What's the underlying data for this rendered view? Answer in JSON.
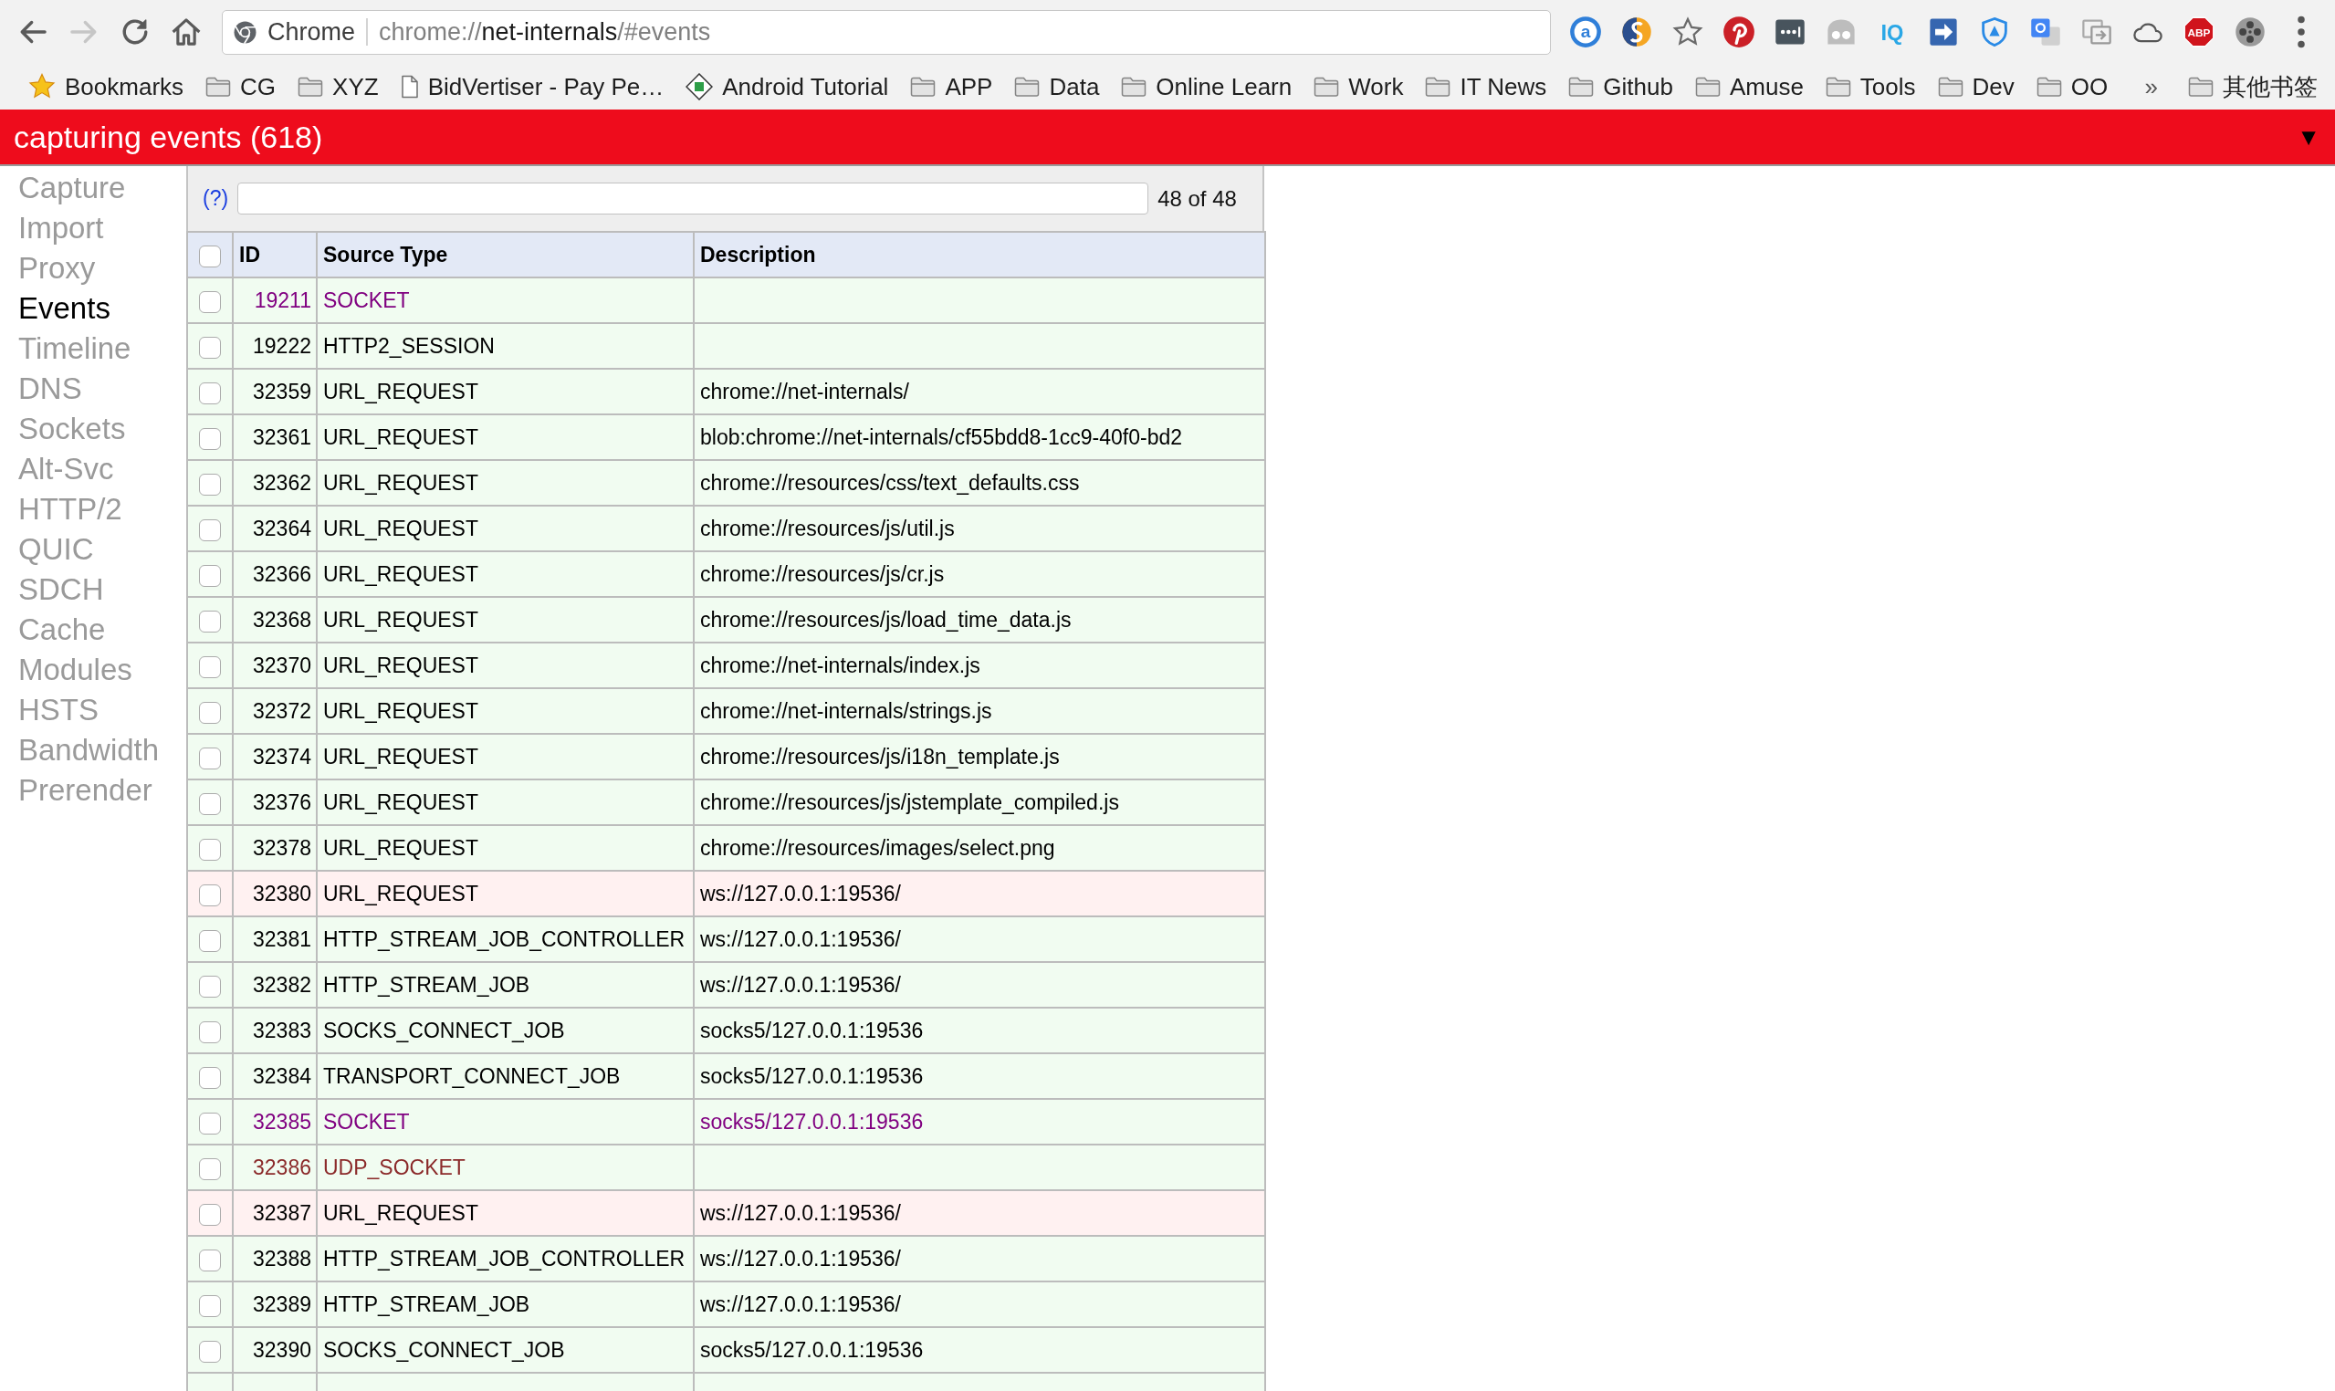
{
  "toolbar": {
    "back_disabled": false,
    "forward_disabled": true,
    "site_label": "Chrome",
    "url": "chrome://net-internals/#events",
    "extension_icon_texts": [
      "a",
      "IQ",
      "ABP"
    ]
  },
  "bookmarks_bar": {
    "items": [
      {
        "label": "Bookmarks",
        "kind": "manager"
      },
      {
        "label": "CG",
        "kind": "folder"
      },
      {
        "label": "XYZ",
        "kind": "folder"
      },
      {
        "label": "BidVertiser - Pay Pe…",
        "kind": "page"
      },
      {
        "label": "Android Tutorial",
        "kind": "site"
      },
      {
        "label": "APP",
        "kind": "folder"
      },
      {
        "label": "Data",
        "kind": "folder"
      },
      {
        "label": "Online Learn",
        "kind": "folder"
      },
      {
        "label": "Work",
        "kind": "folder"
      },
      {
        "label": "IT News",
        "kind": "folder"
      },
      {
        "label": "Github",
        "kind": "folder"
      },
      {
        "label": "Amuse",
        "kind": "folder"
      },
      {
        "label": "Tools",
        "kind": "folder"
      },
      {
        "label": "Dev",
        "kind": "folder"
      },
      {
        "label": "OO",
        "kind": "folder"
      }
    ],
    "overflow": "»",
    "other": {
      "label": "其他书签",
      "kind": "folder"
    }
  },
  "status_bar": {
    "text": "capturing events (618)",
    "toggle": "▼"
  },
  "sidebar": {
    "items": [
      {
        "label": "Capture",
        "selected": false
      },
      {
        "label": "Import",
        "selected": false
      },
      {
        "label": "Proxy",
        "selected": false
      },
      {
        "label": "Events",
        "selected": true
      },
      {
        "label": "Timeline",
        "selected": false
      },
      {
        "label": "DNS",
        "selected": false
      },
      {
        "label": "Sockets",
        "selected": false
      },
      {
        "label": "Alt-Svc",
        "selected": false
      },
      {
        "label": "HTTP/2",
        "selected": false
      },
      {
        "label": "QUIC",
        "selected": false
      },
      {
        "label": "SDCH",
        "selected": false
      },
      {
        "label": "Cache",
        "selected": false
      },
      {
        "label": "Modules",
        "selected": false
      },
      {
        "label": "HSTS",
        "selected": false
      },
      {
        "label": "Bandwidth",
        "selected": false
      },
      {
        "label": "Prerender",
        "selected": false
      }
    ]
  },
  "filter": {
    "help_link": "(?)",
    "count": "48 of 48"
  },
  "table": {
    "select_all_checked": false,
    "columns": [
      "ID",
      "Source Type",
      "Description"
    ],
    "rows": [
      {
        "id": "19211",
        "source_type": "SOCKET",
        "checked": false,
        "error": false,
        "color": "#800080"
      },
      {
        "id": "19222",
        "source_type": "HTTP2_SESSION",
        "checked": false,
        "error": false,
        "color": "#000000"
      },
      {
        "id": "32359",
        "source_type": "URL_REQUEST",
        "description": "chrome://net-internals/",
        "checked": false,
        "error": false,
        "color": "#000000"
      },
      {
        "id": "32361",
        "source_type": "URL_REQUEST",
        "description": "blob:chrome://net-internals/cf55bdd8-1cc9-40f0-bd2",
        "checked": false,
        "error": false,
        "color": "#000000"
      },
      {
        "id": "32362",
        "source_type": "URL_REQUEST",
        "description": "chrome://resources/css/text_defaults.css",
        "checked": false,
        "error": false,
        "color": "#000000"
      },
      {
        "id": "32364",
        "source_type": "URL_REQUEST",
        "description": "chrome://resources/js/util.js",
        "checked": false,
        "error": false,
        "color": "#000000"
      },
      {
        "id": "32366",
        "source_type": "URL_REQUEST",
        "description": "chrome://resources/js/cr.js",
        "checked": false,
        "error": false,
        "color": "#000000"
      },
      {
        "id": "32368",
        "source_type": "URL_REQUEST",
        "description": "chrome://resources/js/load_time_data.js",
        "checked": false,
        "error": false,
        "color": "#000000"
      },
      {
        "id": "32370",
        "source_type": "URL_REQUEST",
        "description": "chrome://net-internals/index.js",
        "checked": false,
        "error": false,
        "color": "#000000"
      },
      {
        "id": "32372",
        "source_type": "URL_REQUEST",
        "description": "chrome://net-internals/strings.js",
        "checked": false,
        "error": false,
        "color": "#000000"
      },
      {
        "id": "32374",
        "source_type": "URL_REQUEST",
        "description": "chrome://resources/js/i18n_template.js",
        "checked": false,
        "error": false,
        "color": "#000000"
      },
      {
        "id": "32376",
        "source_type": "URL_REQUEST",
        "description": "chrome://resources/js/jstemplate_compiled.js",
        "checked": false,
        "error": false,
        "color": "#000000"
      },
      {
        "id": "32378",
        "source_type": "URL_REQUEST",
        "description": "chrome://resources/images/select.png",
        "checked": false,
        "error": false,
        "color": "#000000"
      },
      {
        "id": "32380",
        "source_type": "URL_REQUEST",
        "description": "ws://127.0.0.1:19536/",
        "checked": false,
        "error": true,
        "color": "#000000"
      },
      {
        "id": "32381",
        "source_type": "HTTP_STREAM_JOB_CONTROLLER",
        "description": "ws://127.0.0.1:19536/",
        "checked": false,
        "error": false,
        "color": "#000000"
      },
      {
        "id": "32382",
        "source_type": "HTTP_STREAM_JOB",
        "description": "ws://127.0.0.1:19536/",
        "checked": false,
        "error": false,
        "color": "#000000"
      },
      {
        "id": "32383",
        "source_type": "SOCKS_CONNECT_JOB",
        "description": "socks5/127.0.0.1:19536",
        "checked": false,
        "error": false,
        "color": "#000000"
      },
      {
        "id": "32384",
        "source_type": "TRANSPORT_CONNECT_JOB",
        "description": "socks5/127.0.0.1:19536",
        "checked": false,
        "error": false,
        "color": "#000000"
      },
      {
        "id": "32385",
        "source_type": "SOCKET",
        "description": "socks5/127.0.0.1:19536",
        "checked": false,
        "error": false,
        "color": "#800080"
      },
      {
        "id": "32386",
        "source_type": "UDP_SOCKET",
        "checked": false,
        "error": false,
        "color": "#8b2a2a"
      },
      {
        "id": "32387",
        "source_type": "URL_REQUEST",
        "description": "ws://127.0.0.1:19536/",
        "checked": false,
        "error": true,
        "color": "#000000"
      },
      {
        "id": "32388",
        "source_type": "HTTP_STREAM_JOB_CONTROLLER",
        "description": "ws://127.0.0.1:19536/",
        "checked": false,
        "error": false,
        "color": "#000000"
      },
      {
        "id": "32389",
        "source_type": "HTTP_STREAM_JOB",
        "description": "ws://127.0.0.1:19536/",
        "checked": false,
        "error": false,
        "color": "#000000"
      },
      {
        "id": "32390",
        "source_type": "SOCKS_CONNECT_JOB",
        "description": "socks5/127.0.0.1:19536",
        "checked": false,
        "error": false,
        "color": "#000000"
      }
    ]
  }
}
